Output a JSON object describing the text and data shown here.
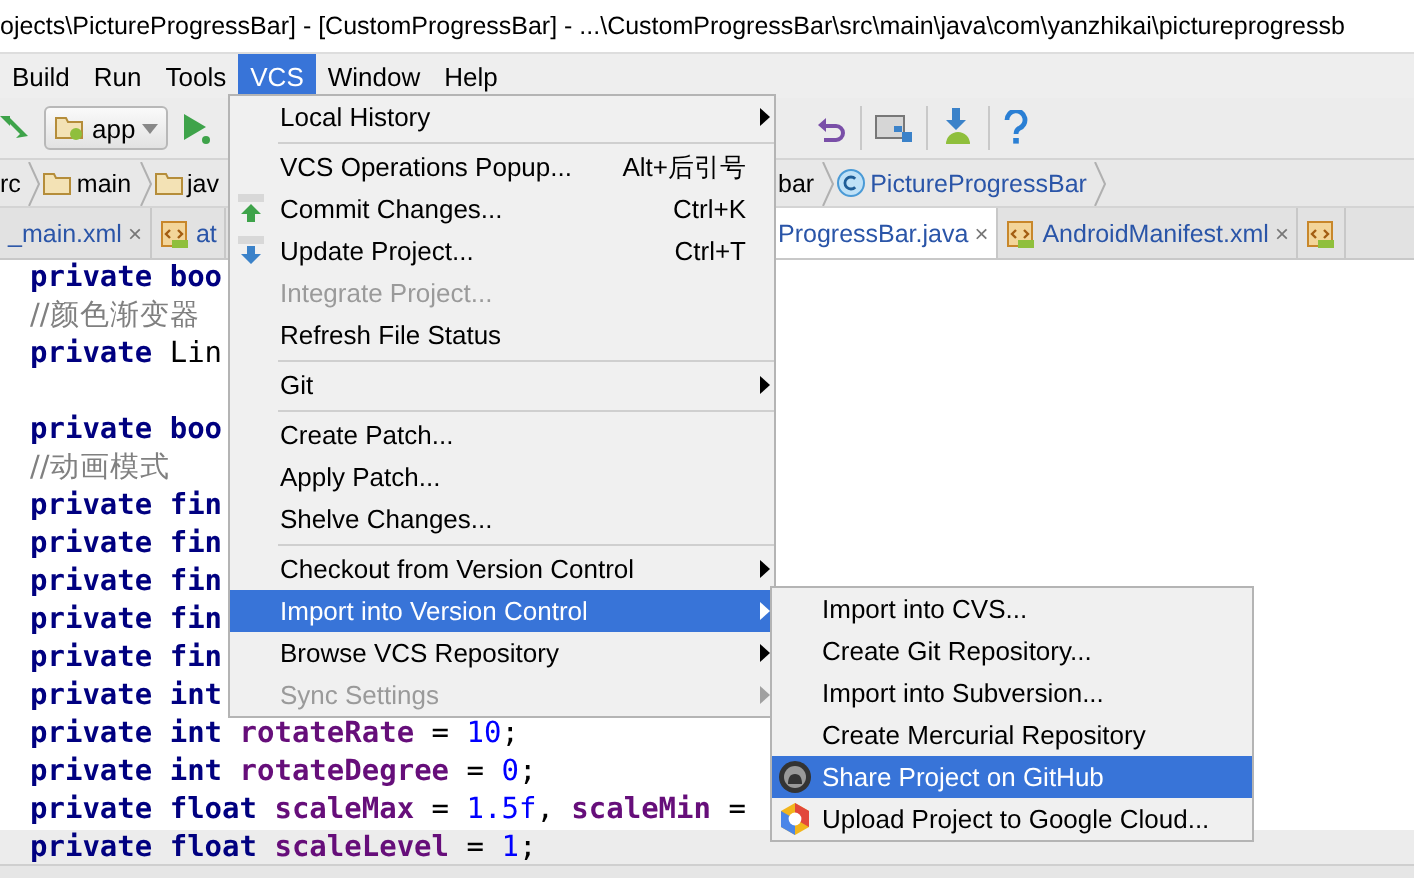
{
  "window": {
    "title": "ojects\\PictureProgressBar] - [CustomProgressBar] - ...\\CustomProgressBar\\src\\main\\java\\com\\yanzhikai\\pictureprogressb"
  },
  "menubar": [
    {
      "label": "Build",
      "selected": false
    },
    {
      "label": "Run",
      "selected": false
    },
    {
      "label": "Tools",
      "selected": false
    },
    {
      "label": "VCS",
      "selected": true
    },
    {
      "label": "Window",
      "selected": false
    },
    {
      "label": "Help",
      "selected": false
    }
  ],
  "toolbar": {
    "run_config": "app"
  },
  "breadcrumb": {
    "left": [
      {
        "label": "rc",
        "kind": "text"
      },
      {
        "label": "main",
        "kind": "folder"
      },
      {
        "label": "jav",
        "kind": "folder"
      }
    ],
    "right": [
      {
        "label": "bar",
        "kind": "text"
      },
      {
        "label": "PictureProgressBar",
        "kind": "class"
      }
    ]
  },
  "tabs": {
    "left": [
      {
        "label": "_main.xml",
        "kind": "text",
        "close": "×",
        "selected": false
      },
      {
        "label": "at",
        "kind": "xml",
        "selected": false
      }
    ],
    "right": [
      {
        "label": "ProgressBar.java",
        "kind": "text",
        "close": "×",
        "selected": true
      },
      {
        "label": "AndroidManifest.xml",
        "kind": "xml",
        "close": "×",
        "selected": false
      },
      {
        "kind": "xml",
        "selected": false
      }
    ]
  },
  "code": [
    [
      {
        "kind": "keyword",
        "text": "private boo"
      }
    ],
    [
      {
        "kind": "comment",
        "text": "//颜色渐变器"
      }
    ],
    [
      {
        "kind": "keyword",
        "text": "private "
      },
      {
        "kind": "plain",
        "text": "Lin"
      }
    ],
    [
      {
        "kind": "blank"
      }
    ],
    [
      {
        "kind": "keyword",
        "text": "private boo"
      }
    ],
    [
      {
        "kind": "comment",
        "text": "//动画模式"
      }
    ],
    [
      {
        "kind": "keyword",
        "text": "private fin"
      }
    ],
    [
      {
        "kind": "keyword",
        "text": "private fin"
      }
    ],
    [
      {
        "kind": "keyword",
        "text": "private fin"
      }
    ],
    [
      {
        "kind": "keyword",
        "text": "private fin"
      }
    ],
    [
      {
        "kind": "keyword",
        "text": "private fin"
      }
    ],
    [
      {
        "kind": "keyword",
        "text": "private int"
      }
    ],
    [
      {
        "kind": "keyword",
        "text": "private int "
      },
      {
        "kind": "field",
        "text": "rotateRate"
      },
      {
        "kind": "plain",
        "text": " = "
      },
      {
        "kind": "number",
        "text": "10"
      },
      {
        "kind": "plain",
        "text": ";"
      }
    ],
    [
      {
        "kind": "keyword",
        "text": "private int "
      },
      {
        "kind": "field",
        "text": "rotateDegree"
      },
      {
        "kind": "plain",
        "text": " = "
      },
      {
        "kind": "number",
        "text": "0"
      },
      {
        "kind": "plain",
        "text": ";"
      }
    ],
    [
      {
        "kind": "keyword",
        "text": "private float "
      },
      {
        "kind": "field",
        "text": "scaleMax"
      },
      {
        "kind": "plain",
        "text": " = "
      },
      {
        "kind": "number",
        "text": "1.5f"
      },
      {
        "kind": "plain",
        "text": ", "
      },
      {
        "kind": "field",
        "text": "scaleMin"
      },
      {
        "kind": "plain",
        "text": " ="
      }
    ],
    [
      {
        "kind": "keyword",
        "text": "private float "
      },
      {
        "kind": "field",
        "text": "scaleLevel"
      },
      {
        "kind": "plain",
        "text": " = "
      },
      {
        "kind": "number",
        "text": "1"
      },
      {
        "kind": "plain",
        "text": ";"
      }
    ]
  ],
  "vcs_menu": [
    {
      "kind": "item",
      "label": "Local History",
      "submenu": true,
      "disabled": false,
      "selected": false
    },
    {
      "kind": "separator"
    },
    {
      "kind": "item",
      "label": "VCS Operations Popup...",
      "shortcut": "Alt+后引号",
      "submenu": false,
      "disabled": false,
      "selected": false
    },
    {
      "kind": "vcs-up",
      "label": "Commit Changes...",
      "shortcut": "Ctrl+K",
      "submenu": false,
      "disabled": false,
      "selected": false
    },
    {
      "kind": "vcs-down",
      "label": "Update Project...",
      "shortcut": "Ctrl+T",
      "submenu": false,
      "disabled": false,
      "selected": false
    },
    {
      "kind": "item",
      "label": "Integrate Project...",
      "submenu": false,
      "disabled": true,
      "selected": false
    },
    {
      "kind": "item",
      "label": "Refresh File Status",
      "submenu": false,
      "disabled": false,
      "selected": false
    },
    {
      "kind": "separator"
    },
    {
      "kind": "item",
      "label": "Git",
      "submenu": true,
      "disabled": false,
      "selected": false
    },
    {
      "kind": "separator"
    },
    {
      "kind": "item",
      "label": "Create Patch...",
      "submenu": false,
      "disabled": false,
      "selected": false
    },
    {
      "kind": "item",
      "label": "Apply Patch...",
      "submenu": false,
      "disabled": false,
      "selected": false
    },
    {
      "kind": "item",
      "label": "Shelve Changes...",
      "submenu": false,
      "disabled": false,
      "selected": false
    },
    {
      "kind": "separator"
    },
    {
      "kind": "item",
      "label": "Checkout from Version Control",
      "submenu": true,
      "disabled": false,
      "selected": false
    },
    {
      "kind": "item",
      "label": "Import into Version Control",
      "submenu": true,
      "disabled": false,
      "selected": true
    },
    {
      "kind": "item",
      "label": "Browse VCS Repository",
      "submenu": true,
      "disabled": false,
      "selected": false
    },
    {
      "kind": "item",
      "label": "Sync Settings",
      "submenu": true,
      "disabled": true,
      "selected": false
    }
  ],
  "import_submenu": [
    {
      "kind": "item",
      "label": "Import into CVS...",
      "selected": false
    },
    {
      "kind": "item",
      "label": "Create Git Repository...",
      "selected": false
    },
    {
      "kind": "item",
      "label": "Import into Subversion...",
      "selected": false
    },
    {
      "kind": "item",
      "label": "Create Mercurial Repository",
      "selected": false
    },
    {
      "kind": "github",
      "label": "Share Project on GitHub",
      "selected": true
    },
    {
      "kind": "cloud",
      "label": "Upload Project to Google Cloud...",
      "selected": false
    }
  ]
}
